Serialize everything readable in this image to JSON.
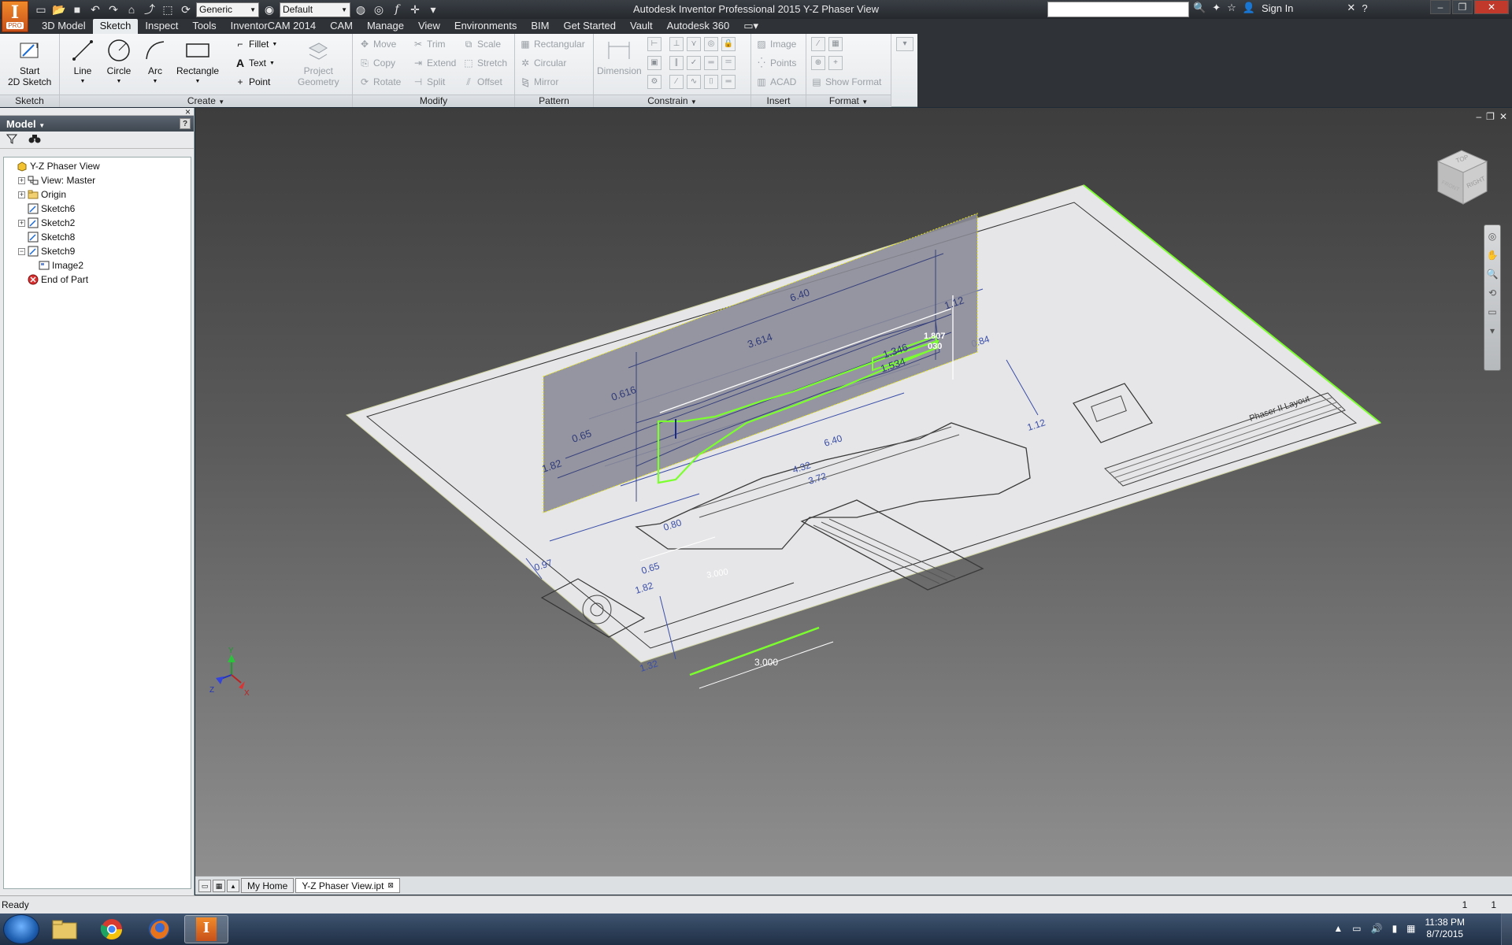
{
  "app": {
    "logo_letter": "I",
    "logo_badge": "PRO",
    "window_title": "Autodesk Inventor Professional 2015   Y-Z Phaser View",
    "search_placeholder": "",
    "sign_in": "Sign In"
  },
  "quick_access": {
    "material": "Generic",
    "appearance": "Default"
  },
  "ribbon_tabs": [
    "3D Model",
    "Sketch",
    "Inspect",
    "Tools",
    "InventorCAM 2014",
    "CAM",
    "Manage",
    "View",
    "Environments",
    "BIM",
    "Get Started",
    "Vault",
    "Autodesk 360"
  ],
  "ribbon_active_tab": "Sketch",
  "ribbon": {
    "sketch_panel": {
      "title": "Sketch",
      "start_line1": "Start",
      "start_line2": "2D Sketch"
    },
    "create_panel": {
      "title": "Create",
      "line": "Line",
      "circle": "Circle",
      "arc": "Arc",
      "rectangle": "Rectangle",
      "fillet": "Fillet",
      "text": "Text",
      "point": "Point",
      "project_line1": "Project",
      "project_line2": "Geometry"
    },
    "modify_panel": {
      "title": "Modify",
      "move": "Move",
      "trim": "Trim",
      "scale": "Scale",
      "copy": "Copy",
      "extend": "Extend",
      "stretch": "Stretch",
      "rotate": "Rotate",
      "split": "Split",
      "offset": "Offset"
    },
    "pattern_panel": {
      "title": "Pattern",
      "rectangular": "Rectangular",
      "circular": "Circular",
      "mirror": "Mirror"
    },
    "constrain_panel": {
      "title": "Constrain",
      "dimension": "Dimension"
    },
    "insert_panel": {
      "title": "Insert",
      "image": "Image",
      "points": "Points",
      "acad": "ACAD"
    },
    "format_panel": {
      "title": "Format",
      "show_format": "Show Format"
    }
  },
  "browser": {
    "title": "Model",
    "help_glyph": "?",
    "close_glyph": "×",
    "tree": [
      {
        "label": "Y-Z Phaser View",
        "level": 0,
        "icon": "part-icon",
        "expander": "none"
      },
      {
        "label": "View: Master",
        "level": 1,
        "icon": "view-rep-icon",
        "expander": "+"
      },
      {
        "label": "Origin",
        "level": 1,
        "icon": "folder-icon",
        "expander": "+"
      },
      {
        "label": "Sketch6",
        "level": 1,
        "icon": "sketch-icon",
        "expander": "none"
      },
      {
        "label": "Sketch2",
        "level": 1,
        "icon": "sketch-icon",
        "expander": "+"
      },
      {
        "label": "Sketch8",
        "level": 1,
        "icon": "sketch-icon",
        "expander": "none"
      },
      {
        "label": "Sketch9",
        "level": 1,
        "icon": "sketch-icon",
        "expander": "-"
      },
      {
        "label": "Image2",
        "level": 2,
        "icon": "image-icon",
        "expander": "none"
      },
      {
        "label": "End of Part",
        "level": 1,
        "icon": "end-of-part-icon",
        "expander": "none"
      }
    ]
  },
  "canvas": {
    "dimension_horizontal": "3.000",
    "dimension_green": "3.000",
    "dimension_a": "1.807",
    "dimension_b": "030",
    "vertical_sketch_dims": [
      "6.40",
      "3.614",
      "0.616",
      "0.65",
      "1.82",
      "1.12",
      "1.346",
      "1.534"
    ],
    "sheet_dims": [
      "6.40",
      "4.32",
      "3.72",
      "0.80",
      "0.65",
      "0.97",
      "1.82",
      "1.32",
      "1.12",
      "0.84"
    ],
    "title_block_title": "Phaser II Layout",
    "view_cube_faces": [
      "TOP",
      "RIGHT",
      "FRONT"
    ],
    "triad": {
      "x": "X",
      "y": "Y",
      "z": "Z"
    },
    "colors": {
      "highlight_green": "#7cff2e",
      "sheet": "#e6e6e8",
      "sketch_plane": "#8a8a96"
    }
  },
  "doc_tabs": [
    {
      "label": "My Home",
      "active": false
    },
    {
      "label": "Y-Z Phaser View.ipt",
      "active": true
    }
  ],
  "status": {
    "text": "Ready",
    "count_a": "1",
    "count_b": "1"
  },
  "taskbar": {
    "time": "11:38 PM",
    "date": "8/7/2015"
  }
}
